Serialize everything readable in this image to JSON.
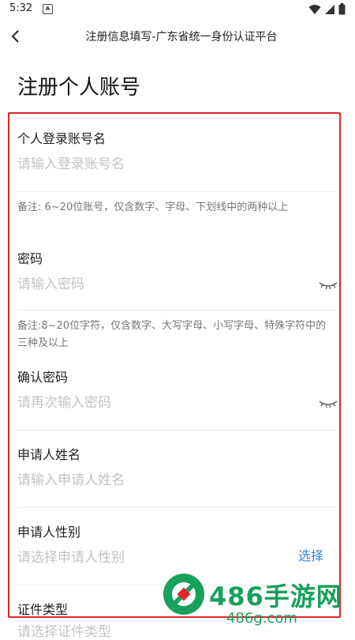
{
  "status_bar": {
    "time": "5:32",
    "app_icon_letter": "A"
  },
  "nav": {
    "title": "注册信息填写-广东省统一身份认证平台"
  },
  "page": {
    "title": "注册个人账号"
  },
  "form": {
    "account": {
      "label": "个人登录账号名",
      "placeholder": "请输入登录账号名",
      "note": "备注: 6~20位账号，仅含数字、字母、下划线中的两种以上"
    },
    "password": {
      "label": "密码",
      "placeholder": "请输入密码",
      "note": "备注:8~20位字符，仅含数字、大写字母、小写字母、特殊字符中的三种及以上"
    },
    "confirm_password": {
      "label": "确认密码",
      "placeholder": "请再次输入密码"
    },
    "applicant_name": {
      "label": "申请人姓名",
      "placeholder": "请输入申请人姓名"
    },
    "applicant_gender": {
      "label": "申请人性别",
      "placeholder": "请选择申请人性别",
      "select_label": "选择"
    },
    "id_type": {
      "label": "证件类型",
      "placeholder": "请选择证件类型"
    }
  },
  "watermark": {
    "main": "486手游网",
    "sub": "486g.com"
  },
  "colors": {
    "frame": "#e0262a",
    "link": "#3b82e0",
    "watermark": "#19a05a"
  }
}
